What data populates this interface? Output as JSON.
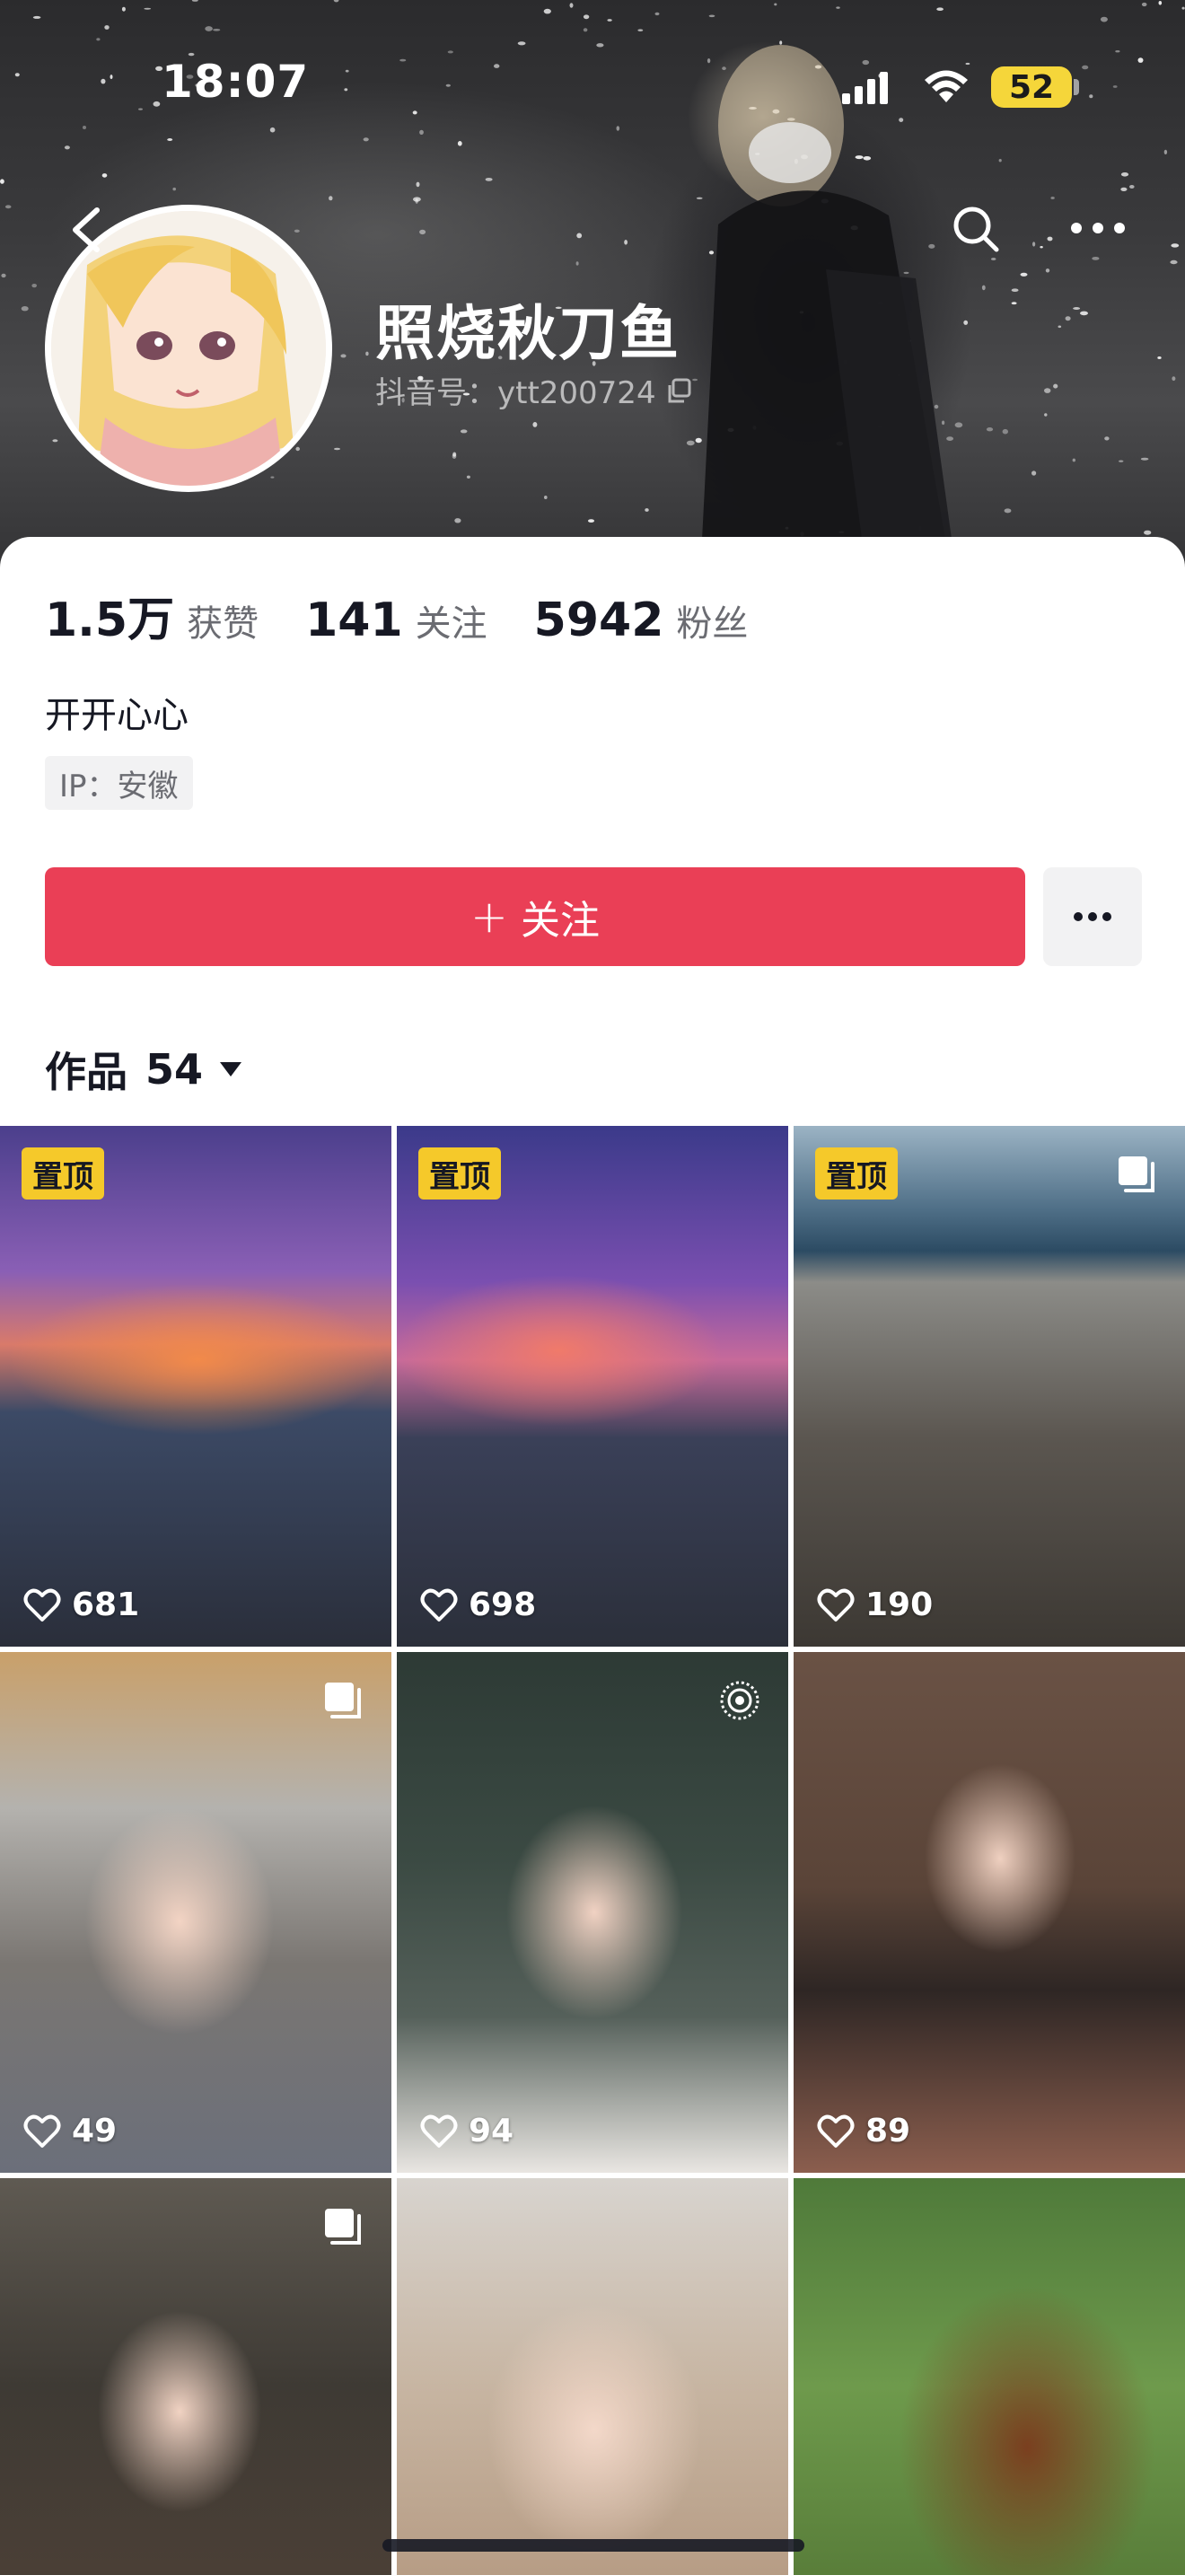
{
  "status_bar": {
    "time": "18:07",
    "battery": "52"
  },
  "profile": {
    "nickname": "照烧秋刀鱼",
    "douyin_id": "抖音号：ytt200724",
    "bio": "开开心心",
    "ip": "IP：安徽"
  },
  "stats": [
    {
      "value": "1.5万",
      "label": "获赞"
    },
    {
      "value": "141",
      "label": "关注"
    },
    {
      "value": "5942",
      "label": "粉丝"
    }
  ],
  "actions": {
    "follow_label": "关注",
    "follow_plus": "+"
  },
  "tabs": {
    "works_label": "作品",
    "works_count": "54"
  },
  "pin_label": "置顶",
  "videos": [
    {
      "likes": "681",
      "pinned": true,
      "corner": "",
      "scene": "sunset-beach"
    },
    {
      "likes": "698",
      "pinned": true,
      "corner": "",
      "scene": "sunset-palm"
    },
    {
      "likes": "190",
      "pinned": true,
      "corner": "gallery",
      "scene": "ocean-drinks"
    },
    {
      "likes": "49",
      "pinned": false,
      "corner": "gallery",
      "scene": "girl-hat"
    },
    {
      "likes": "94",
      "pinned": false,
      "corner": "live-photo",
      "scene": "girl-dark"
    },
    {
      "likes": "89",
      "pinned": false,
      "corner": "",
      "scene": "girl-dinner"
    },
    {
      "likes": "",
      "pinned": false,
      "corner": "gallery",
      "scene": "girl-restaurant"
    },
    {
      "likes": "",
      "pinned": false,
      "corner": "",
      "scene": "girl-closeup"
    },
    {
      "likes": "",
      "pinned": false,
      "corner": "",
      "scene": "cartoon-bear"
    }
  ],
  "colors": {
    "follow": "#ea3f56",
    "pin": "#f5c92a",
    "battery": "#f5d63a"
  }
}
